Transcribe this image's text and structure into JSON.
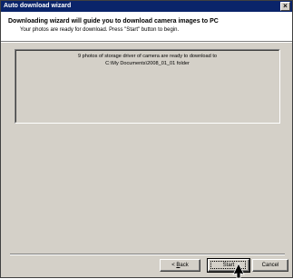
{
  "window": {
    "title": "Auto download wizard",
    "close_glyph": "×"
  },
  "header": {
    "title": "Downloading wizard will guide you to download camera images to PC",
    "subtitle": "Your photos are ready for download. Press \"Start\" button to begin."
  },
  "message": {
    "line1": "9 photos of storage driver of camera are ready to download to",
    "line2": "C:\\My Documents\\2008_01_01 folder"
  },
  "buttons": {
    "back_mnemonic": "B",
    "back_rest": "ack",
    "back_prefix": "< ",
    "start": "Start",
    "cancel": "Cancel"
  },
  "icons": {
    "cursor": "arrow-cursor-icon"
  }
}
